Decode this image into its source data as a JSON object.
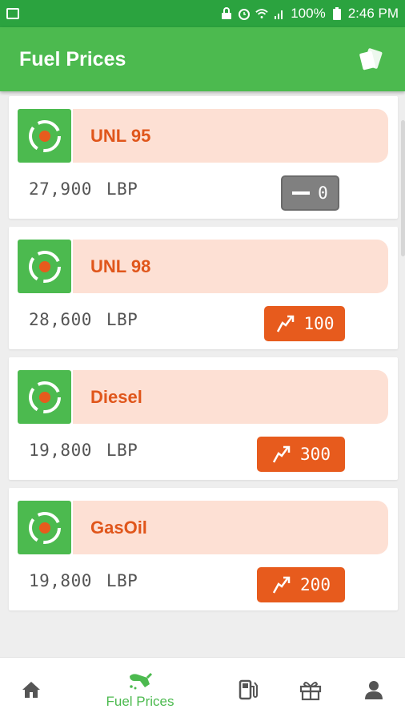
{
  "status_bar": {
    "battery": "100%",
    "time": "2:46 PM",
    "icons": [
      "image-icon",
      "lock-icon",
      "alarm-icon",
      "wifi-icon",
      "signal-icon",
      "battery-icon"
    ]
  },
  "app_bar": {
    "title": "Fuel Prices",
    "action_icon": "cards-icon"
  },
  "colors": {
    "status_bar": "#2ba33f",
    "app_bar": "#4cba4f",
    "accent_orange": "#e75b1d",
    "banner": "#fde0d4",
    "flat_badge": "#808080"
  },
  "fuels": [
    {
      "name": "UNL 95",
      "price": "27,900",
      "currency": "LBP",
      "change": "0",
      "trend": "flat"
    },
    {
      "name": "UNL 98",
      "price": "28,600",
      "currency": "LBP",
      "change": "100",
      "trend": "up"
    },
    {
      "name": "Diesel",
      "price": "19,800",
      "currency": "LBP",
      "change": "300",
      "trend": "up"
    },
    {
      "name": "GasOil",
      "price": "19,800",
      "currency": "LBP",
      "change": "200",
      "trend": "up"
    }
  ],
  "bottom_nav": {
    "items": [
      {
        "icon": "home-icon",
        "label": ""
      },
      {
        "icon": "fuel-nozzle-icon",
        "label": "Fuel Prices",
        "active": true
      },
      {
        "icon": "gas-station-icon",
        "label": ""
      },
      {
        "icon": "gift-icon",
        "label": ""
      },
      {
        "icon": "person-icon",
        "label": ""
      }
    ]
  }
}
